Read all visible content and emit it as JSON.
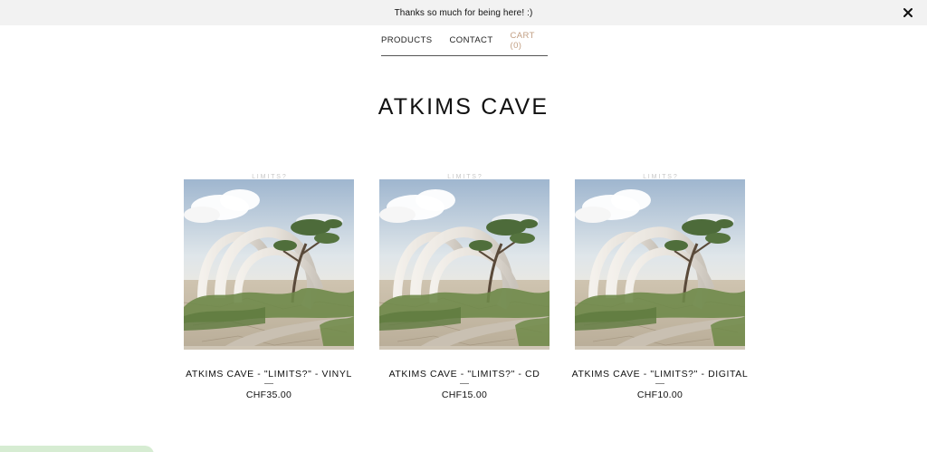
{
  "announcement": {
    "text": "Thanks so much for being here! :)",
    "close_icon": "close-icon"
  },
  "nav": {
    "items": [
      {
        "label": "PRODUCTS"
      },
      {
        "label": "CONTACT"
      },
      {
        "label": "CART (0)"
      }
    ],
    "cart_color": "#c29f83"
  },
  "site": {
    "title": "ATKIMS CAVE"
  },
  "products": [
    {
      "name": "ATKIMS CAVE - \"LIMITS?\" - VINYL",
      "price": "CHF35.00",
      "art_text": "L I M I T S ?"
    },
    {
      "name": "ATKIMS CAVE - \"LIMITS?\" - CD",
      "price": "CHF15.00",
      "art_text": "L I M I T S ?"
    },
    {
      "name": "ATKIMS CAVE - \"LIMITS?\" - DIGITAL",
      "price": "CHF10.00",
      "art_text": "L I M I T S ?"
    }
  ]
}
